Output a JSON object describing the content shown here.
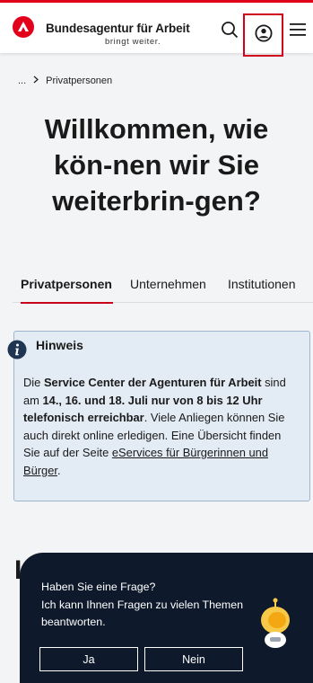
{
  "header": {
    "brand_name": "Bundesagentur für Arbeit",
    "brand_tagline": "bringt weiter.",
    "brand_color": "#e2001a"
  },
  "icons": {
    "logo": "ba-logo-icon",
    "search": "search-icon",
    "account": "user-account-icon",
    "menu": "hamburger-menu-icon",
    "breadcrumb_separator": "chevron-right-icon",
    "notice": "info-icon",
    "chatbot": "robot-assistant-icon"
  },
  "breadcrumb": {
    "ellipsis": "...",
    "current": "Privatpersonen"
  },
  "page": {
    "title": "Willkommen, wie kön-nen wir Sie weiterbrin-gen?"
  },
  "tabs": [
    {
      "label": "Privatpersonen",
      "active": true
    },
    {
      "label": "Unternehmen",
      "active": false
    },
    {
      "label": "Institutionen",
      "active": false
    }
  ],
  "notice": {
    "title": "Hinweis",
    "text_1": "Die ",
    "bold_1": "Service Center der Agenturen für Arbeit",
    "text_2": " sind am ",
    "bold_2": "14., 16. und 18. Juli nur von 8 bis 12 Uhr telefonisch erreichbar",
    "text_3": ". Viele Anliegen können Sie auch direkt online erledigen. Eine Übersicht finden Sie auf der Seite ",
    "link": "eServices für Bürgerinnen und Bürger",
    "text_4": "."
  },
  "bottom": {
    "fragment": "I"
  },
  "chat": {
    "question": "Haben Sie eine Frage?",
    "subtitle": "Ich kann Ihnen Fragen zu vielen Themen beantworten.",
    "yes_label": "Ja",
    "no_label": "Nein"
  }
}
